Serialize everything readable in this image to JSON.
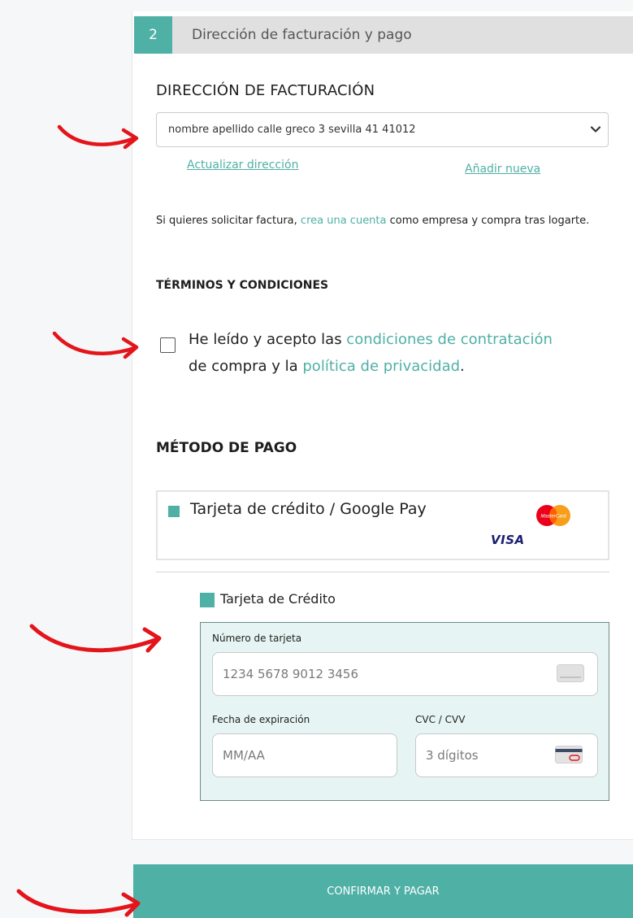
{
  "step": {
    "number": "2",
    "title": "Dirección de facturación y pago"
  },
  "billing": {
    "heading": "DIRECCIÓN DE FACTURACIÓN",
    "selected_address": "nombre apellido calle greco 3 sevilla 41 41012",
    "update_link": "Actualizar dirección",
    "add_link": "Añadir nueva"
  },
  "invoice_info": {
    "before": "Si quieres solicitar factura, ",
    "link": "crea una cuenta",
    "after": " como empresa y compra tras logarte."
  },
  "terms": {
    "heading": "TÉRMINOS Y CONDICIONES",
    "checked": false,
    "text_before": "He leído y acepto las ",
    "link1": "condiciones de contratación",
    "text_mid": " de compra y la ",
    "link2": "política de privacidad",
    "text_end": "."
  },
  "payment": {
    "heading": "MÉTODO DE PAGO",
    "method_label": "Tarjeta de crédito / Google Pay",
    "mastercard_text": "MasterCard",
    "visa_text": "VISA",
    "card_option_label": "Tarjeta de Crédito",
    "card_number_label": "Número de tarjeta",
    "card_number_placeholder": "1234 5678 9012 3456",
    "expiry_label": "Fecha de expiración",
    "expiry_placeholder": "MM/AA",
    "cvc_label": "CVC / CVV",
    "cvc_placeholder": "3 dígitos"
  },
  "confirm_button": "CONFIRMAR Y PAGAR",
  "colors": {
    "accent": "#4fb0a6",
    "arrow": "#e3151b",
    "form_bg": "#e6f5f3"
  },
  "icons": [
    "chevron-down-icon",
    "mastercard-logo",
    "visa-logo",
    "card-icon",
    "card-back-icon",
    "red-arrow-icon"
  ]
}
